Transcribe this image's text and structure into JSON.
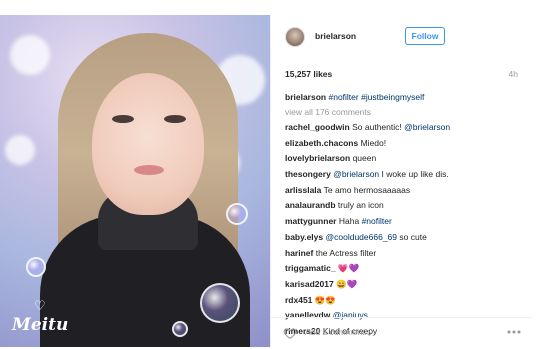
{
  "post": {
    "username": "brielarson",
    "follow_label": "Follow",
    "likes": "15,257 likes",
    "time": "4h",
    "caption": {
      "user": "brielarson",
      "text": "#nofilter #justbeingmyself"
    },
    "view_all": "view all 176 comments",
    "photo_watermark": "Meitu"
  },
  "comments": [
    {
      "user": "rachel_goodwin",
      "text": "So authentic! @brielarson"
    },
    {
      "user": "elizabeth.chacons",
      "text": "Miedo!"
    },
    {
      "user": "lovelybrielarson",
      "text": "queen"
    },
    {
      "user": "thesongery",
      "text": "@brielarson I woke up like dis."
    },
    {
      "user": "arlisslala",
      "text": "Te amo hermosaaaaas"
    },
    {
      "user": "analaurandb",
      "text": "truly an icon"
    },
    {
      "user": "mattygunner",
      "text": "Haha #nofilter"
    },
    {
      "user": "baby.elys",
      "text": "@cooldude666_69 so cute"
    },
    {
      "user": "harinef",
      "text": "the Actress filter"
    },
    {
      "user": "triggamatic_",
      "text": "💗💜"
    },
    {
      "user": "karisad2017",
      "text": "😄💜"
    },
    {
      "user": "rdx451",
      "text": "😍😍"
    },
    {
      "user": "yanellevdw",
      "text": "@janiuys"
    },
    {
      "user": "rimers20",
      "text": "Kind of creepy"
    }
  ],
  "footer": {
    "add_comment_placeholder": "Add a comment...",
    "like_icon": "heart-icon",
    "more_icon": "more-dots-icon"
  },
  "colors": {
    "link": "#003569",
    "follow": "#3897f0",
    "muted": "#999999"
  }
}
